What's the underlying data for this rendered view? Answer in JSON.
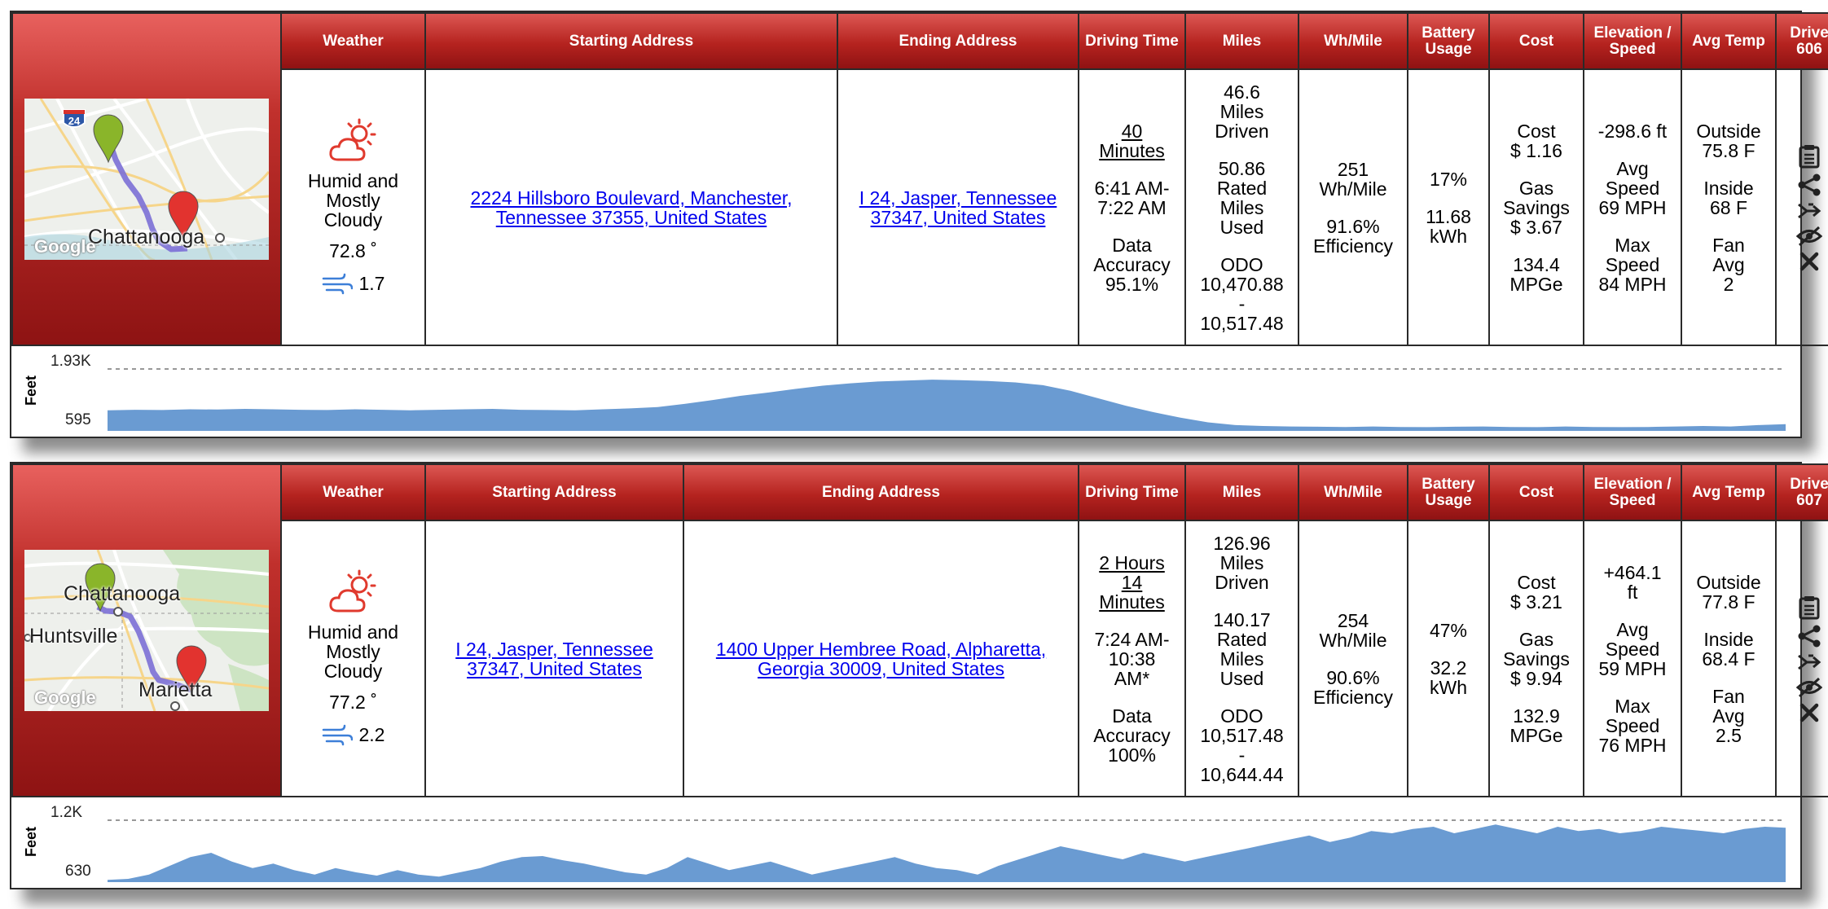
{
  "headers": [
    "Weather",
    "Starting Address",
    "Ending Address",
    "Driving Time",
    "Miles",
    "Wh/Mile",
    "Battery Usage",
    "Cost",
    "Elevation / Speed",
    "Avg Temp"
  ],
  "colors": {
    "header_red": "#b5231f",
    "chart_fill": "#6a9bd2",
    "link": "#0000ee",
    "pin_start": "#8ab52a",
    "pin_end": "#e2332f",
    "route": "#7b6fd6"
  },
  "icons": [
    "partly-cloudy-icon",
    "wind-icon",
    "log-icon",
    "share-icon",
    "merge-icon",
    "hide-icon",
    "close-icon"
  ],
  "drives": [
    {
      "drive_label_1": "Drive",
      "drive_label_2": "606",
      "map": {
        "labels": [
          "Chattanooga"
        ],
        "watermark": "Google",
        "shield": "24"
      },
      "weather": {
        "condition_1": "Humid and",
        "condition_2": "Mostly",
        "condition_3": "Cloudy",
        "temp": "72.8 ˚",
        "wind": "1.7"
      },
      "start_address": "2224 Hillsboro Boulevard, Manchester, Tennessee 37355, United States",
      "end_address": "I 24, Jasper, Tennessee 37347, United States",
      "time": {
        "duration_1": "40",
        "duration_2": "Minutes",
        "duration_3": "",
        "range_1": "6:41 AM-",
        "range_2": "7:22 AM",
        "acc_1": "Data",
        "acc_2": "Accuracy",
        "acc_3": "95.1%"
      },
      "miles": {
        "driven_1": "46.6",
        "driven_2": "Miles",
        "driven_3": "Driven",
        "rated_1": "50.86",
        "rated_2": "Rated",
        "rated_3": "Miles",
        "rated_4": "Used",
        "odo_1": "ODO",
        "odo_2": "10,470.88",
        "odo_3": "-",
        "odo_4": "10,517.48"
      },
      "whmile": {
        "value_1": "251",
        "value_2": "Wh/Mile",
        "eff_1": "91.6%",
        "eff_2": "Efficiency"
      },
      "battery": {
        "pct": "17%",
        "kwh_1": "11.68",
        "kwh_2": "kWh"
      },
      "cost": {
        "cost_1": "Cost",
        "cost_2": "$ 1.16",
        "sav_1": "Gas",
        "sav_2": "Savings",
        "sav_3": "$ 3.67",
        "mpge_1": "134.4",
        "mpge_2": "MPGe"
      },
      "elev": {
        "elev_1": "-298.6 ft",
        "elev_2": "",
        "avg_1": "Avg",
        "avg_2": "Speed",
        "avg_3": "69 MPH",
        "max_1": "Max",
        "max_2": "Speed",
        "max_3": "84 MPH"
      },
      "temp": {
        "out_1": "Outside",
        "out_2": "75.8 F",
        "in_1": "Inside",
        "in_2": "68 F",
        "fan_1": "Fan",
        "fan_2": "Avg",
        "fan_3": "2"
      },
      "chart_data": {
        "type": "area",
        "ylabel": "Feet",
        "y_ticks": [
          "1.93K",
          "595"
        ],
        "ylim": [
          595,
          1930
        ],
        "values": [
          1040,
          1050,
          1045,
          1060,
          1055,
          1070,
          1060,
          1050,
          1045,
          1060,
          1050,
          1040,
          1050,
          1060,
          1070,
          1050,
          1045,
          1040,
          1060,
          1080,
          1110,
          1180,
          1260,
          1350,
          1420,
          1500,
          1570,
          1620,
          1660,
          1680,
          1700,
          1690,
          1670,
          1640,
          1580,
          1460,
          1300,
          1140,
          1000,
          880,
          780,
          720,
          700,
          690,
          685,
          680,
          690,
          680,
          675,
          685,
          690,
          680,
          675,
          690,
          680,
          675,
          680,
          690,
          700,
          690,
          720,
          740
        ]
      }
    },
    {
      "drive_label_1": "Drive",
      "drive_label_2": "607",
      "map": {
        "labels": [
          "Chattanooga",
          "Huntsville",
          "Marietta"
        ],
        "watermark": "Google",
        "shield": ""
      },
      "weather": {
        "condition_1": "Humid and",
        "condition_2": "Mostly",
        "condition_3": "Cloudy",
        "temp": "77.2 ˚",
        "wind": "2.2"
      },
      "start_address": "I 24, Jasper, Tennessee 37347, United States",
      "end_address": "1400 Upper Hembree Road, Alpharetta, Georgia 30009, United States",
      "time": {
        "duration_1": "2 Hours",
        "duration_2": "14",
        "duration_3": "Minutes",
        "range_1": "7:24 AM-",
        "range_2": "10:38",
        "range_3": "AM*",
        "acc_1": "Data",
        "acc_2": "Accuracy",
        "acc_3": "100%"
      },
      "miles": {
        "driven_1": "126.96",
        "driven_2": "Miles",
        "driven_3": "Driven",
        "rated_1": "140.17",
        "rated_2": "Rated",
        "rated_3": "Miles",
        "rated_4": "Used",
        "odo_1": "ODO",
        "odo_2": "10,517.48",
        "odo_3": "-",
        "odo_4": "10,644.44"
      },
      "whmile": {
        "value_1": "254",
        "value_2": "Wh/Mile",
        "eff_1": "90.6%",
        "eff_2": "Efficiency"
      },
      "battery": {
        "pct": "47%",
        "kwh_1": "32.2",
        "kwh_2": "kWh"
      },
      "cost": {
        "cost_1": "Cost",
        "cost_2": "$ 3.21",
        "sav_1": "Gas",
        "sav_2": "Savings",
        "sav_3": "$ 9.94",
        "mpge_1": "132.9",
        "mpge_2": "MPGe"
      },
      "elev": {
        "elev_1": "+464.1",
        "elev_2": "ft",
        "avg_1": "Avg",
        "avg_2": "Speed",
        "avg_3": "59 MPH",
        "max_1": "Max",
        "max_2": "Speed",
        "max_3": "76 MPH"
      },
      "temp": {
        "out_1": "Outside",
        "out_2": "77.8 F",
        "in_1": "Inside",
        "in_2": "68.4 F",
        "fan_1": "Fan",
        "fan_2": "Avg",
        "fan_3": "2.5"
      },
      "chart_data": {
        "type": "area",
        "ylabel": "Feet",
        "y_ticks": [
          "1.2K",
          "630"
        ],
        "ylim": [
          630,
          1200
        ],
        "values": [
          650,
          660,
          700,
          780,
          860,
          900,
          820,
          760,
          800,
          740,
          700,
          760,
          720,
          690,
          740,
          700,
          680,
          720,
          760,
          820,
          860,
          870,
          830,
          800,
          760,
          720,
          700,
          760,
          860,
          800,
          740,
          780,
          820,
          760,
          700,
          740,
          780,
          820,
          860,
          800,
          760,
          740,
          700,
          780,
          840,
          900,
          960,
          920,
          880,
          840,
          900,
          860,
          820,
          860,
          900,
          940,
          980,
          1020,
          1060,
          1000,
          1040,
          1100,
          1080,
          1120,
          1140,
          1080,
          1120,
          1160,
          1120,
          1080,
          1140,
          1100,
          1120,
          1080,
          1100,
          1140,
          1120,
          1100,
          1080,
          1120,
          1140,
          1130
        ]
      }
    }
  ]
}
